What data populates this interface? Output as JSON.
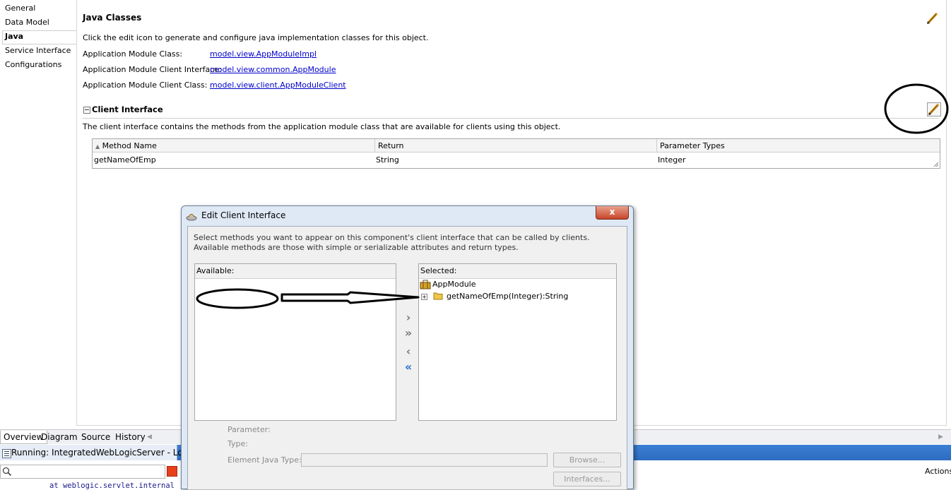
{
  "nav": {
    "items": [
      "General",
      "Data Model",
      "Java",
      "Service Interface",
      "Configurations"
    ]
  },
  "java_classes": {
    "title": "Java Classes",
    "description": "Click the edit icon to generate and configure java implementation classes for this object.",
    "rows": [
      {
        "label": "Application Module Class:",
        "value": "model.view.AppModuleImpl"
      },
      {
        "label": "Application Module Client Interface:",
        "value": "model.view.common.AppModule"
      },
      {
        "label": "Application Module Client Class:",
        "value": "model.view.client.AppModuleClient"
      }
    ]
  },
  "client_interface": {
    "title": "Client Interface",
    "description": "The client interface contains the methods from the application module class that are available for clients using this object.",
    "columns": [
      "Method Name",
      "Return",
      "Parameter Types"
    ],
    "rows": [
      {
        "method": "getNameOfEmp",
        "return": "String",
        "params": "Integer"
      }
    ]
  },
  "dialog": {
    "title": "Edit Client Interface",
    "close_label": "x",
    "instructions": "Select methods you want to appear on this component's client interface that can be called by clients.  Available methods are those with simple or serializable attributes and return types.",
    "available_label": "Available:",
    "selected_label": "Selected:",
    "tree_root": "AppModule",
    "tree_child": "getNameOfEmp(Integer):String",
    "parameter_label": "Parameter:",
    "type_label": "Type:",
    "element_type_label": "Element Java Type:",
    "element_type_value": "",
    "browse_label": "Browse...",
    "interfaces_label": "Interfaces..."
  },
  "bottom_tabs": [
    "Overview",
    "Diagram",
    "Source",
    "History"
  ],
  "log": {
    "title": "Running: IntegratedWebLogicServer - Log",
    "search_value": "",
    "actions_label": "Actions",
    "log_line": "at weblogic.servlet.internal"
  },
  "colors": {
    "link": "#0000cc",
    "dialog_frame": "#dfe9f5",
    "stop_button": "#e8401c",
    "shuttle_active": "#2a6fce"
  },
  "icons": [
    "pencil-icon",
    "collapse-icon",
    "sort-asc-icon",
    "folder-icon",
    "briefcase-icon",
    "expand-icon",
    "move-right-icon",
    "move-all-right-icon",
    "move-left-icon",
    "move-all-left-icon",
    "close-icon",
    "search-icon",
    "stop-icon",
    "log-icon",
    "dialog-app-icon"
  ]
}
